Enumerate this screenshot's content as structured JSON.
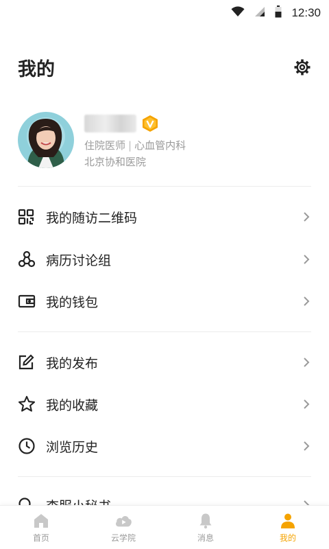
{
  "status_bar": {
    "time": "12:30",
    "icons": [
      "wifi-icon",
      "signal-icon",
      "battery-icon"
    ]
  },
  "header": {
    "title": "我的",
    "settings_icon": "gear-icon"
  },
  "profile": {
    "name": "",
    "badge_icon": "v-badge-icon",
    "role": "住院医师",
    "department": "心血管内科",
    "hospital": "北京协和医院"
  },
  "menu": {
    "group1": [
      {
        "label": "我的随访二维码",
        "icon": "qr-code-icon"
      },
      {
        "label": "病历讨论组",
        "icon": "discussion-group-icon"
      },
      {
        "label": "我的钱包",
        "icon": "wallet-icon"
      }
    ],
    "group2": [
      {
        "label": "我的发布",
        "icon": "edit-icon"
      },
      {
        "label": "我的收藏",
        "icon": "star-icon"
      },
      {
        "label": "浏览历史",
        "icon": "clock-icon"
      }
    ],
    "group3": [
      {
        "label": "查服小秘书",
        "icon": "search-icon"
      }
    ]
  },
  "tab_bar": {
    "tabs": [
      {
        "label": "首页",
        "icon": "home-icon"
      },
      {
        "label": "云学院",
        "icon": "cloud-play-icon"
      },
      {
        "label": "消息",
        "icon": "bell-icon"
      },
      {
        "label": "我的",
        "icon": "person-icon"
      }
    ],
    "active_index": 3
  },
  "colors": {
    "accent": "#f5a300",
    "text_primary": "#222222",
    "text_secondary": "#9a9a9a",
    "divider": "#ececec",
    "tab_inactive": "#c8c8c8"
  }
}
